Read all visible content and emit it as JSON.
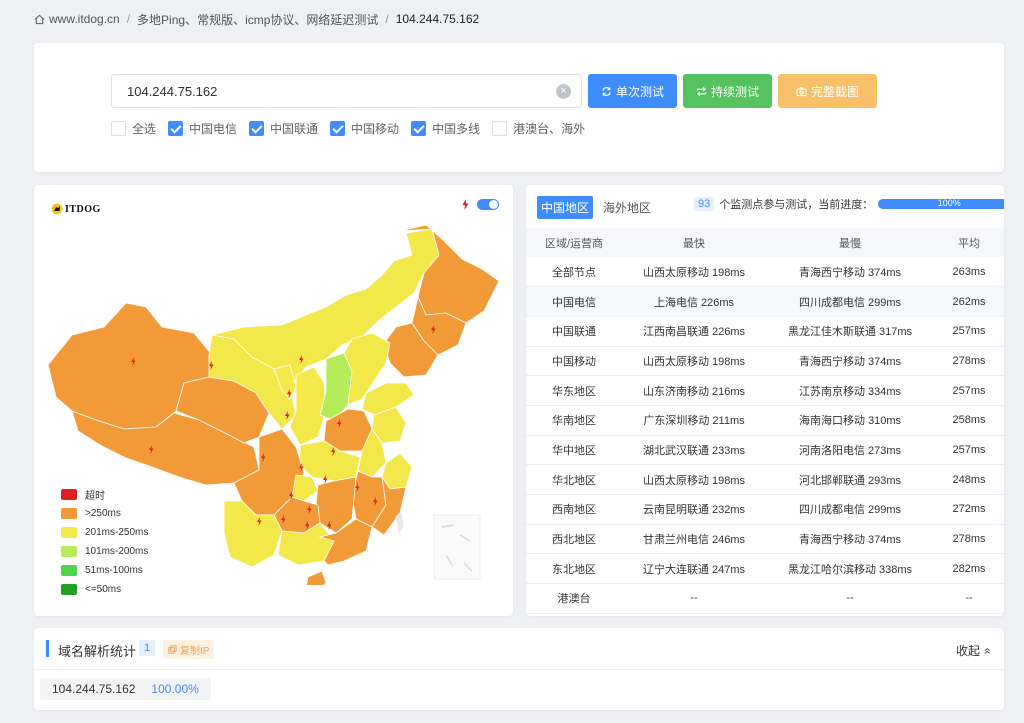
{
  "breadcrumb": {
    "home": "www.itdog.cn",
    "page": "多地Ping、常规版、icmp协议、网络延迟测试",
    "current": "104.244.75.162"
  },
  "search": {
    "value": "104.244.75.162",
    "single_btn": "单次测试",
    "continuous_btn": "持续测试",
    "screenshot_btn": "完整截图"
  },
  "checks": [
    {
      "label": "全选",
      "checked": false
    },
    {
      "label": "中国电信",
      "checked": true
    },
    {
      "label": "中国联通",
      "checked": true
    },
    {
      "label": "中国移动",
      "checked": true
    },
    {
      "label": "中国多线",
      "checked": true
    },
    {
      "label": "港澳台、海外",
      "checked": false
    }
  ],
  "map": {
    "logo": "ITDOG",
    "logo_sub": "www.itdog.cn",
    "legend": [
      {
        "label": "超时",
        "color": "#e02020"
      },
      {
        "label": ">250ms",
        "color": "#f39a38"
      },
      {
        "label": "201ms-250ms",
        "color": "#f3e84a"
      },
      {
        "label": "101ms-200ms",
        "color": "#b6ec5a"
      },
      {
        "label": "51ms-100ms",
        "color": "#4fd44f"
      },
      {
        "label": "<=50ms",
        "color": "#22a122"
      }
    ]
  },
  "stats": {
    "tab_china": "中国地区",
    "tab_overseas": "海外地区",
    "node_count": "93",
    "progress_text": "个监测点参与测试，当前进度：",
    "progress": "100%",
    "progress_value": 100,
    "columns": [
      "区域/运营商",
      "最快",
      "最慢",
      "平均"
    ],
    "rows": [
      [
        "全部节点",
        "山西太原移动 198ms",
        "青海西宁移动 374ms",
        "263ms"
      ],
      [
        "中国电信",
        "上海电信 226ms",
        "四川成都电信 299ms",
        "262ms"
      ],
      [
        "中国联通",
        "江西南昌联通 226ms",
        "黑龙江佳木斯联通 317ms",
        "257ms"
      ],
      [
        "中国移动",
        "山西太原移动 198ms",
        "青海西宁移动 374ms",
        "278ms"
      ],
      [
        "华东地区",
        "山东济南移动 216ms",
        "江苏南京移动 334ms",
        "257ms"
      ],
      [
        "华南地区",
        "广东深圳移动 211ms",
        "海南海口移动 310ms",
        "258ms"
      ],
      [
        "华中地区",
        "湖北武汉联通 233ms",
        "河南洛阳电信 273ms",
        "257ms"
      ],
      [
        "华北地区",
        "山西太原移动 198ms",
        "河北邯郸联通 293ms",
        "248ms"
      ],
      [
        "西南地区",
        "云南昆明联通 232ms",
        "四川成都电信 299ms",
        "272ms"
      ],
      [
        "西北地区",
        "甘肃兰州电信 246ms",
        "青海西宁移动 374ms",
        "278ms"
      ],
      [
        "东北地区",
        "辽宁大连联通 247ms",
        "黑龙江哈尔滨移动 338ms",
        "282ms"
      ],
      [
        "港澳台",
        "--",
        "--",
        "--"
      ]
    ]
  },
  "dns": {
    "title": "域名解析统计",
    "count": "1",
    "copy_btn": "复制IP",
    "collapse": "收起",
    "ip": "104.244.75.162",
    "percent": "100.00%"
  },
  "colors": {
    "primary": "#3f8cfc",
    "success": "#54c25e",
    "warning": "#f8c169",
    "orange": "#f39a38",
    "yellow": "#f3e84a",
    "light_green": "#b6ec5a"
  }
}
